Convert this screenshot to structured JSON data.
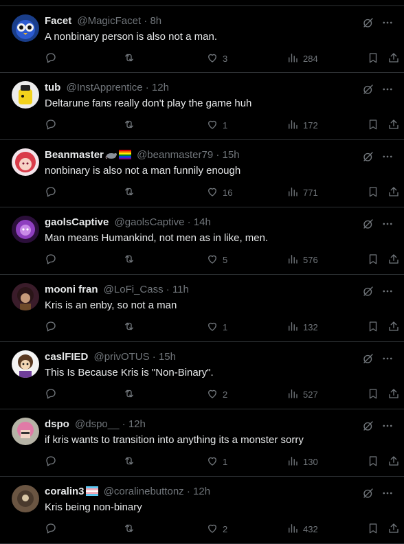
{
  "posts": [
    {
      "name": "Facet",
      "handle": "@MagicFacet",
      "time": "8h",
      "text": "A nonbinary person is also not a man.",
      "replies": "",
      "retweets": "",
      "likes": "3",
      "views": "284",
      "badges": [],
      "avatar": "blue-owl-avatar"
    },
    {
      "name": "tub",
      "handle": "@InstApprentice",
      "time": "12h",
      "text": "Deltarune fans really don't play the game huh",
      "replies": "",
      "retweets": "",
      "likes": "1",
      "views": "172",
      "badges": [],
      "avatar": "yellow-character-avatar"
    },
    {
      "name": "Beanmaster",
      "handle": "@beanmaster79",
      "time": "15h",
      "text": "nonbinary is also not a man funnily enough",
      "replies": "",
      "retweets": "",
      "likes": "16",
      "views": "771",
      "badges": [
        "rat-emoji",
        "rainbow-flag-emoji"
      ],
      "avatar": "red-hair-avatar"
    },
    {
      "name": "gaolsCaptive",
      "handle": "@gaolsCaptive",
      "time": "14h",
      "text": "Man means Humankind, not men as in like, men.",
      "replies": "",
      "retweets": "",
      "likes": "5",
      "views": "576",
      "badges": [],
      "avatar": "purple-character-avatar"
    },
    {
      "name": "mooni fran",
      "handle": "@LoFi_Cass",
      "time": "11h",
      "text": "Kris is an enby, so not a man",
      "replies": "",
      "retweets": "",
      "likes": "1",
      "views": "132",
      "badges": [],
      "avatar": "dark-hair-avatar"
    },
    {
      "name": "caslFIED",
      "handle": "@privOTUS",
      "time": "15h",
      "text": "This Is Because Kris is \"Non-Binary\".",
      "replies": "",
      "retweets": "",
      "likes": "2",
      "views": "527",
      "badges": [],
      "avatar": "brown-hair-avatar"
    },
    {
      "name": "dspo",
      "handle": "@dspo__",
      "time": "12h",
      "text": "if kris wants to transition into anything its a monster sorry",
      "replies": "",
      "retweets": "",
      "likes": "1",
      "views": "130",
      "badges": [],
      "avatar": "pink-hair-avatar"
    },
    {
      "name": "coralin3",
      "handle": "@coralinebuttonz",
      "time": "12h",
      "text": "Kris being non-binary",
      "replies": "",
      "retweets": "",
      "likes": "2",
      "views": "432",
      "badges": [
        "trans-flag-emoji"
      ],
      "avatar": "brown-photo-avatar"
    }
  ],
  "colors": {
    "background": "#000000",
    "text": "#e7e9ea",
    "muted": "#71767b",
    "border": "#2f3336"
  },
  "separator": "·"
}
